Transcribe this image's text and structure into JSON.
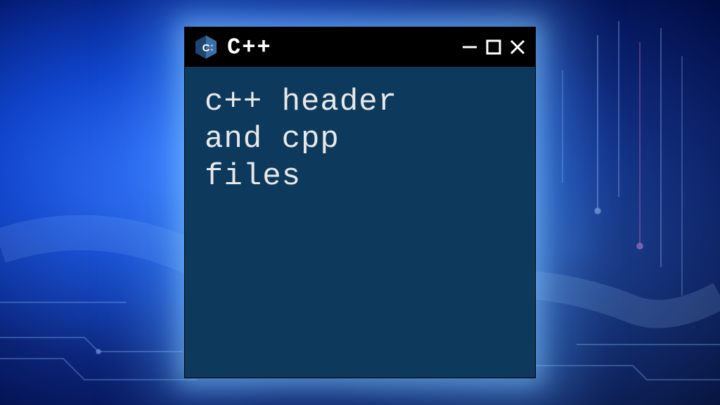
{
  "window": {
    "title": "C++",
    "icon_name": "cpp-logo-icon",
    "content_text": "c++ header\nand cpp\nfiles"
  },
  "colors": {
    "titlebar_bg": "#000000",
    "window_bg": "#0d3a5c",
    "text": "#e8e8e8",
    "glow": "#64b4ff"
  }
}
